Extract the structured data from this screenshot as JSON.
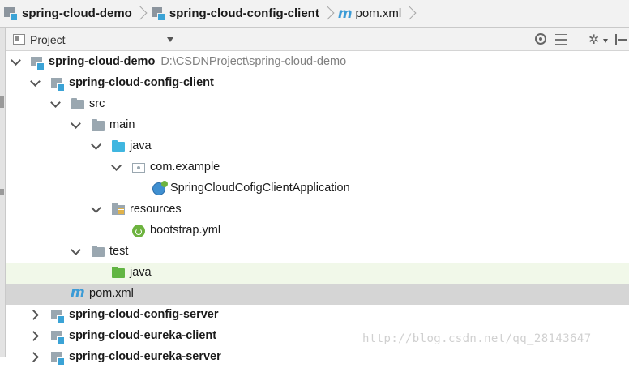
{
  "breadcrumb": {
    "items": [
      {
        "label": "spring-cloud-demo",
        "icon": "module-icon"
      },
      {
        "label": "spring-cloud-config-client",
        "icon": "module-icon"
      },
      {
        "label": "pom.xml",
        "icon": "maven-icon",
        "glyph": "m"
      }
    ]
  },
  "toolbar": {
    "title": "Project",
    "gear_glyph": "✲"
  },
  "tree": {
    "root": {
      "label": "spring-cloud-demo",
      "path": "D:\\CSDNProject\\spring-cloud-demo"
    },
    "config_client": {
      "label": "spring-cloud-config-client"
    },
    "src": {
      "label": "src"
    },
    "main": {
      "label": "main"
    },
    "java_main": {
      "label": "java"
    },
    "package": {
      "label": "com.example"
    },
    "app_class": {
      "label": "SpringCloudCofigClientApplication"
    },
    "resources": {
      "label": "resources"
    },
    "bootstrap": {
      "label": "bootstrap.yml"
    },
    "test": {
      "label": "test"
    },
    "java_test": {
      "label": "java"
    },
    "pom": {
      "label": "pom.xml",
      "glyph": "m"
    },
    "config_server": {
      "label": "spring-cloud-config-server"
    },
    "eureka_client": {
      "label": "spring-cloud-eureka-client"
    },
    "eureka_server": {
      "label": "spring-cloud-eureka-server"
    }
  },
  "watermark": "http://blog.csdn.net/qq_28143647",
  "colors": {
    "selection_gray": "#d5d5d5",
    "highlight_green": "#f1f8e9",
    "folder_blue": "#40b6e0",
    "folder_green": "#62b543",
    "maven_blue": "#3b9bd6"
  }
}
